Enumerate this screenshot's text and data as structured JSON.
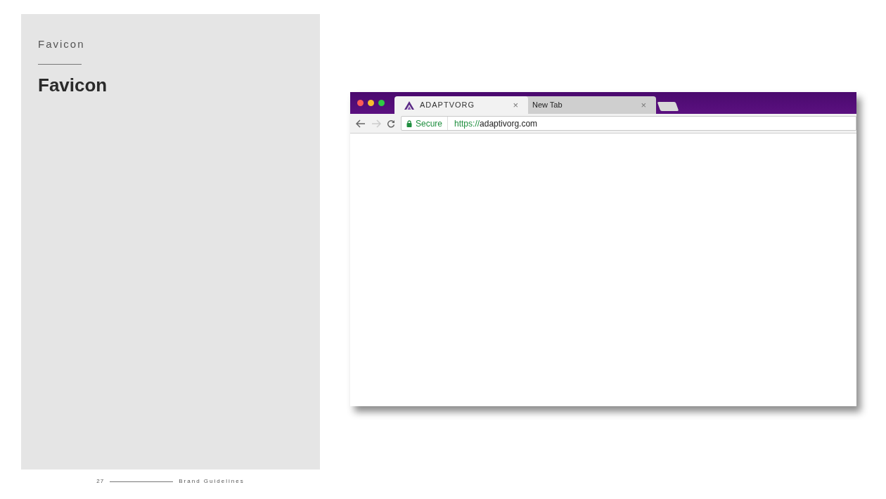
{
  "section_label": "Favicon",
  "heading": "Favicon",
  "browser": {
    "tabs": [
      {
        "title": "ADAPTVORG",
        "close": "×",
        "selected": true,
        "favicon": true
      },
      {
        "title": "New Tab",
        "close": "×",
        "selected": false,
        "favicon": false
      }
    ],
    "security": "Secure",
    "url_scheme": "https://",
    "url_host": "adaptivorg.com"
  },
  "footer": {
    "page": "27",
    "title": "Brand Guidelines"
  }
}
